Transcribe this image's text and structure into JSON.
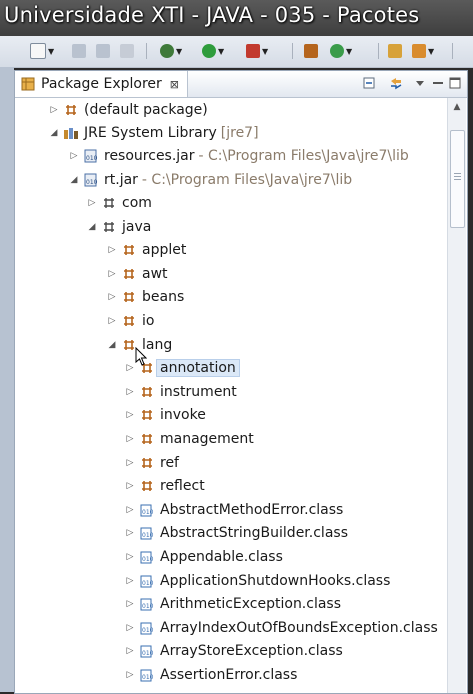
{
  "title_bar": {
    "title": "Universidade XTI - JAVA - 035 - Pacotes"
  },
  "view": {
    "tab_label": "Package Explorer",
    "close_glyph": "⊠"
  },
  "tree": {
    "default_package": "(default package)",
    "jre_library": "JRE System Library",
    "jre_library_decor": "[jre7]",
    "resources_jar": "resources.jar",
    "resources_jar_decor": "- C:\\Program Files\\Java\\jre7\\lib",
    "rt_jar": "rt.jar",
    "rt_jar_decor": "- C:\\Program Files\\Java\\jre7\\lib",
    "pkg_com": "com",
    "pkg_java": "java",
    "java_packages": [
      "applet",
      "awt",
      "beans",
      "io",
      "lang"
    ],
    "lang_packages": [
      "annotation",
      "instrument",
      "invoke",
      "management",
      "ref",
      "reflect"
    ],
    "lang_classes": [
      "AbstractMethodError.class",
      "AbstractStringBuilder.class",
      "Appendable.class",
      "ApplicationShutdownHooks.class",
      "ArithmeticException.class",
      "ArrayIndexOutOfBoundsException.class",
      "ArrayStoreException.class",
      "AssertionError.class"
    ]
  },
  "colors": {
    "package_icon": "#b5651d",
    "library_icon": "#c68a2e",
    "jar_icon": "#4a6fa5",
    "class_icon": "#3a6fb0",
    "selection": "#dbe8f7"
  },
  "icons": {
    "package": "package-icon",
    "library": "library-icon",
    "jar": "jar-icon",
    "class_file": "class-file-icon",
    "package_explorer": "package-explorer-icon"
  }
}
